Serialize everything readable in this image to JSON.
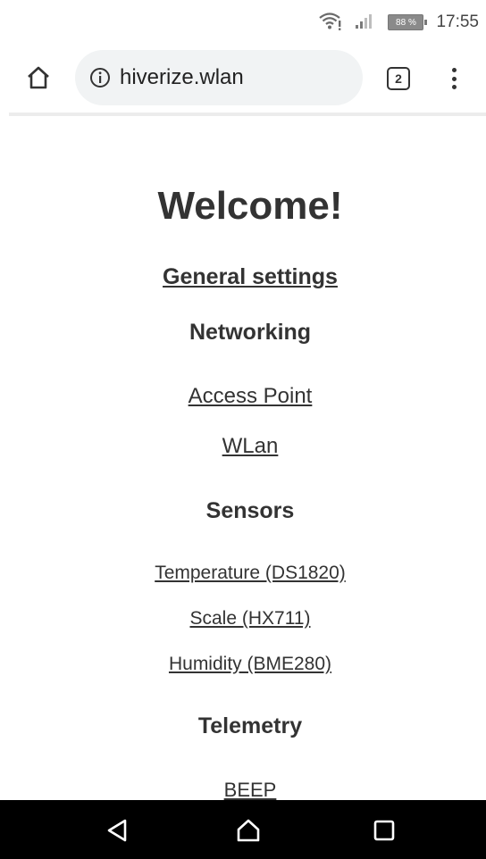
{
  "status_bar": {
    "battery": "88 %",
    "time": "17:55",
    "icons": [
      "wifi-icon",
      "signal-icon",
      "battery-icon"
    ]
  },
  "toolbar": {
    "url": "hiverize.wlan",
    "tab_count": "2",
    "icons": [
      "home-icon",
      "info-icon",
      "tabs-icon",
      "more-vert-icon"
    ]
  },
  "page": {
    "title": "Welcome!",
    "general_settings": "General settings",
    "networking": {
      "heading": "Networking",
      "links": [
        "Access Point",
        "WLan"
      ]
    },
    "sensors": {
      "heading": "Sensors",
      "links": [
        "Temperature (DS1820)",
        "Scale (HX711)",
        "Humidity (BME280)"
      ]
    },
    "telemetry": {
      "heading": "Telemetry",
      "links": [
        "BEEP"
      ]
    }
  },
  "nav_bar": {
    "icons": [
      "back-icon",
      "home-icon",
      "recents-icon"
    ]
  }
}
